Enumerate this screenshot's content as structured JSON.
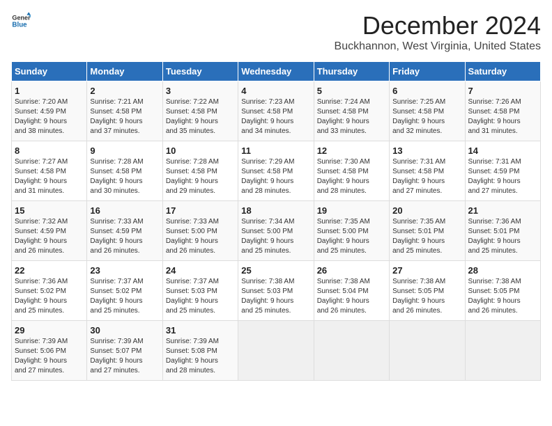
{
  "header": {
    "logo_general": "General",
    "logo_blue": "Blue",
    "month_year": "December 2024",
    "location": "Buckhannon, West Virginia, United States"
  },
  "days_of_week": [
    "Sunday",
    "Monday",
    "Tuesday",
    "Wednesday",
    "Thursday",
    "Friday",
    "Saturday"
  ],
  "weeks": [
    [
      {
        "day": "1",
        "info": "Sunrise: 7:20 AM\nSunset: 4:59 PM\nDaylight: 9 hours\nand 38 minutes."
      },
      {
        "day": "2",
        "info": "Sunrise: 7:21 AM\nSunset: 4:58 PM\nDaylight: 9 hours\nand 37 minutes."
      },
      {
        "day": "3",
        "info": "Sunrise: 7:22 AM\nSunset: 4:58 PM\nDaylight: 9 hours\nand 35 minutes."
      },
      {
        "day": "4",
        "info": "Sunrise: 7:23 AM\nSunset: 4:58 PM\nDaylight: 9 hours\nand 34 minutes."
      },
      {
        "day": "5",
        "info": "Sunrise: 7:24 AM\nSunset: 4:58 PM\nDaylight: 9 hours\nand 33 minutes."
      },
      {
        "day": "6",
        "info": "Sunrise: 7:25 AM\nSunset: 4:58 PM\nDaylight: 9 hours\nand 32 minutes."
      },
      {
        "day": "7",
        "info": "Sunrise: 7:26 AM\nSunset: 4:58 PM\nDaylight: 9 hours\nand 31 minutes."
      }
    ],
    [
      {
        "day": "8",
        "info": "Sunrise: 7:27 AM\nSunset: 4:58 PM\nDaylight: 9 hours\nand 31 minutes."
      },
      {
        "day": "9",
        "info": "Sunrise: 7:28 AM\nSunset: 4:58 PM\nDaylight: 9 hours\nand 30 minutes."
      },
      {
        "day": "10",
        "info": "Sunrise: 7:28 AM\nSunset: 4:58 PM\nDaylight: 9 hours\nand 29 minutes."
      },
      {
        "day": "11",
        "info": "Sunrise: 7:29 AM\nSunset: 4:58 PM\nDaylight: 9 hours\nand 28 minutes."
      },
      {
        "day": "12",
        "info": "Sunrise: 7:30 AM\nSunset: 4:58 PM\nDaylight: 9 hours\nand 28 minutes."
      },
      {
        "day": "13",
        "info": "Sunrise: 7:31 AM\nSunset: 4:58 PM\nDaylight: 9 hours\nand 27 minutes."
      },
      {
        "day": "14",
        "info": "Sunrise: 7:31 AM\nSunset: 4:59 PM\nDaylight: 9 hours\nand 27 minutes."
      }
    ],
    [
      {
        "day": "15",
        "info": "Sunrise: 7:32 AM\nSunset: 4:59 PM\nDaylight: 9 hours\nand 26 minutes."
      },
      {
        "day": "16",
        "info": "Sunrise: 7:33 AM\nSunset: 4:59 PM\nDaylight: 9 hours\nand 26 minutes."
      },
      {
        "day": "17",
        "info": "Sunrise: 7:33 AM\nSunset: 5:00 PM\nDaylight: 9 hours\nand 26 minutes."
      },
      {
        "day": "18",
        "info": "Sunrise: 7:34 AM\nSunset: 5:00 PM\nDaylight: 9 hours\nand 25 minutes."
      },
      {
        "day": "19",
        "info": "Sunrise: 7:35 AM\nSunset: 5:00 PM\nDaylight: 9 hours\nand 25 minutes."
      },
      {
        "day": "20",
        "info": "Sunrise: 7:35 AM\nSunset: 5:01 PM\nDaylight: 9 hours\nand 25 minutes."
      },
      {
        "day": "21",
        "info": "Sunrise: 7:36 AM\nSunset: 5:01 PM\nDaylight: 9 hours\nand 25 minutes."
      }
    ],
    [
      {
        "day": "22",
        "info": "Sunrise: 7:36 AM\nSunset: 5:02 PM\nDaylight: 9 hours\nand 25 minutes."
      },
      {
        "day": "23",
        "info": "Sunrise: 7:37 AM\nSunset: 5:02 PM\nDaylight: 9 hours\nand 25 minutes."
      },
      {
        "day": "24",
        "info": "Sunrise: 7:37 AM\nSunset: 5:03 PM\nDaylight: 9 hours\nand 25 minutes."
      },
      {
        "day": "25",
        "info": "Sunrise: 7:38 AM\nSunset: 5:03 PM\nDaylight: 9 hours\nand 25 minutes."
      },
      {
        "day": "26",
        "info": "Sunrise: 7:38 AM\nSunset: 5:04 PM\nDaylight: 9 hours\nand 26 minutes."
      },
      {
        "day": "27",
        "info": "Sunrise: 7:38 AM\nSunset: 5:05 PM\nDaylight: 9 hours\nand 26 minutes."
      },
      {
        "day": "28",
        "info": "Sunrise: 7:38 AM\nSunset: 5:05 PM\nDaylight: 9 hours\nand 26 minutes."
      }
    ],
    [
      {
        "day": "29",
        "info": "Sunrise: 7:39 AM\nSunset: 5:06 PM\nDaylight: 9 hours\nand 27 minutes."
      },
      {
        "day": "30",
        "info": "Sunrise: 7:39 AM\nSunset: 5:07 PM\nDaylight: 9 hours\nand 27 minutes."
      },
      {
        "day": "31",
        "info": "Sunrise: 7:39 AM\nSunset: 5:08 PM\nDaylight: 9 hours\nand 28 minutes."
      },
      {
        "day": "",
        "info": ""
      },
      {
        "day": "",
        "info": ""
      },
      {
        "day": "",
        "info": ""
      },
      {
        "day": "",
        "info": ""
      }
    ]
  ]
}
